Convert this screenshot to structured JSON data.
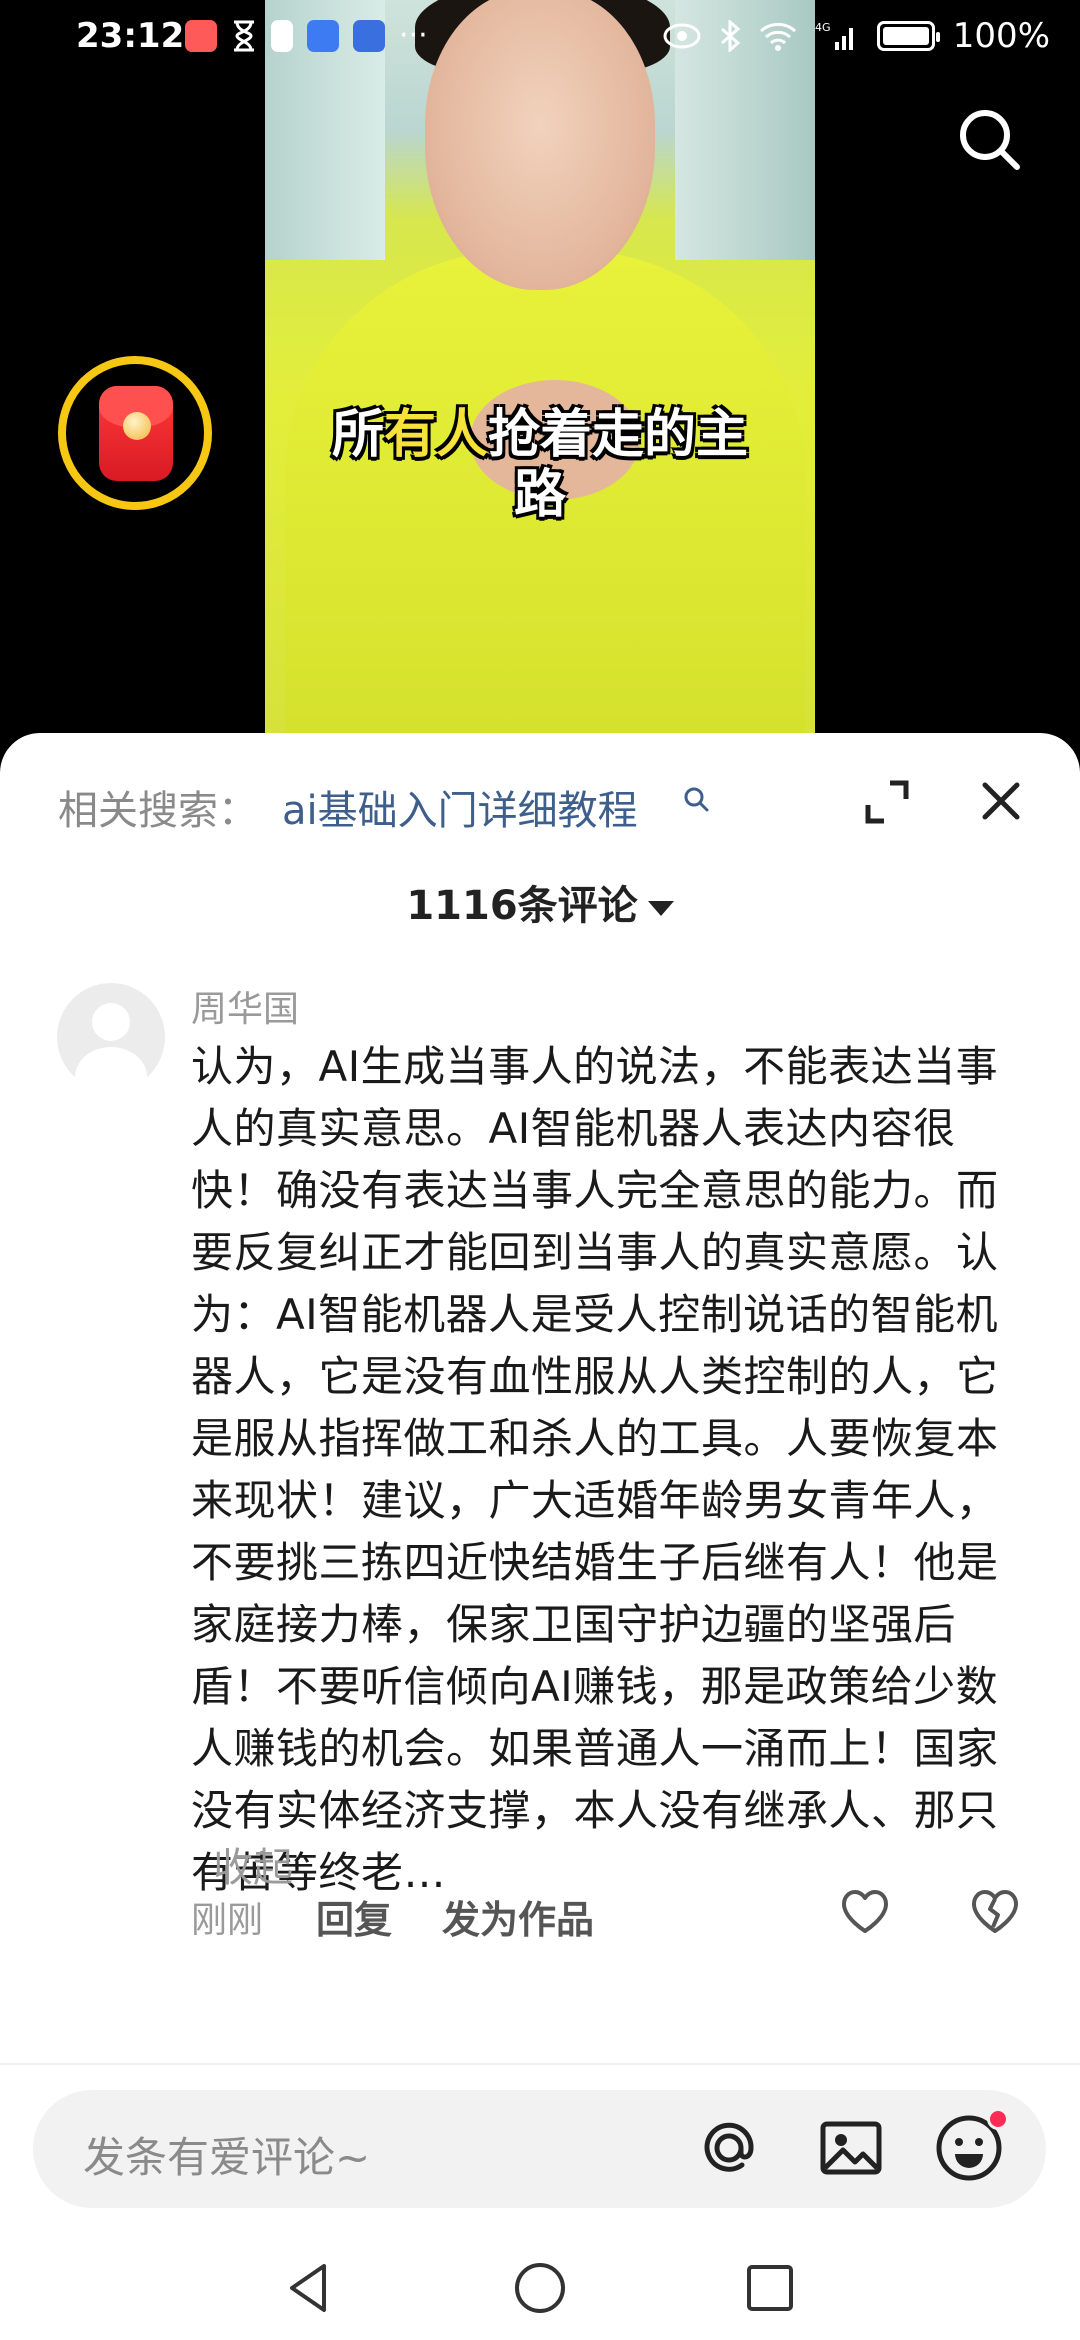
{
  "status_bar": {
    "time": "23:12",
    "battery": "100%",
    "network": "4G"
  },
  "video": {
    "caption_line1_a": "所",
    "caption_line1_hl": "有人",
    "caption_line1_b": "抢着走的主",
    "caption_line2": "路"
  },
  "related_search": {
    "label": "相关搜索：",
    "query": "ai基础入门详细教程"
  },
  "comments_header": {
    "count_label": "1116条评论"
  },
  "comment": {
    "username": "周华国",
    "text": "认为，AI生成当事人的说法，不能表达当事人的真实意思。AI智能机器人表达内容很快！确没有表达当事人完全意思的能力。而要反复纠正才能回到当事人的真实意愿。认为：AI智能机器人是受人控制说话的智能机器人，它是没有血性服从人类控制的人，它是服从指挥做工和杀人的工具。人要恢复本来现状！建议，广大适婚年龄男女青年人，不要挑三拣四近快结婚生子后继有人！他是家庭接力棒，保家卫国守护边疆的坚强后盾！不要听信倾向AI赚钱，那是政策给少数人赚钱的机会。如果普通人一涌而上！国家没有实体经济支撑，本人没有继承人、那只有苦等终老…",
    "collapse_label": "收起",
    "time": "刚刚",
    "reply_label": "回复",
    "publish_label": "发为作品"
  },
  "input_bar": {
    "placeholder": "发条有爱评论~"
  },
  "icons": {
    "search": "search-icon",
    "close": "close-icon",
    "expand": "expand-icon",
    "like": "heart-icon",
    "dislike": "broken-heart-icon",
    "mention": "at-icon",
    "image": "image-icon",
    "emoji": "emoji-icon"
  },
  "colors": {
    "accent_link": "#3e5f8c",
    "redpacket_ring": "#f6c814",
    "notification_dot": "#ff2d55"
  }
}
